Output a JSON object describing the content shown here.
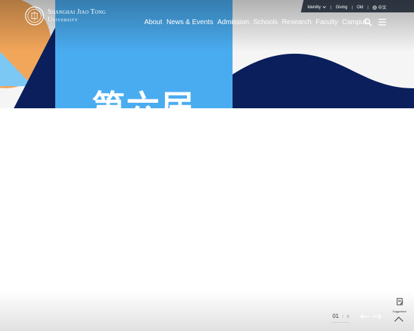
{
  "header": {
    "logo_line1": "Shanghai Jiao Tong",
    "logo_line2": "University",
    "utility": {
      "identity": "Identity",
      "giving": "Giving",
      "old": "Old",
      "language": "中文"
    },
    "nav": [
      "About",
      "News & Events",
      "Admission",
      "Schools",
      "Research",
      "Faculty",
      "Campus"
    ]
  },
  "hero": {
    "title": "第六届"
  },
  "pager": {
    "current": "01",
    "separator": "/",
    "total": "6"
  },
  "suggestion": {
    "label": "Suggestion"
  },
  "colors": {
    "navy": "#0a1f5c",
    "sky": "#4aacf0",
    "orange": "#f2a65a",
    "light_blue": "#7cc8f5"
  },
  "icons": [
    "seal-icon",
    "chevron-down-icon",
    "globe-icon",
    "search-icon",
    "menu-icon",
    "arrow-left-icon",
    "arrow-right-icon",
    "suggestion-icon",
    "chevron-up-icon"
  ]
}
